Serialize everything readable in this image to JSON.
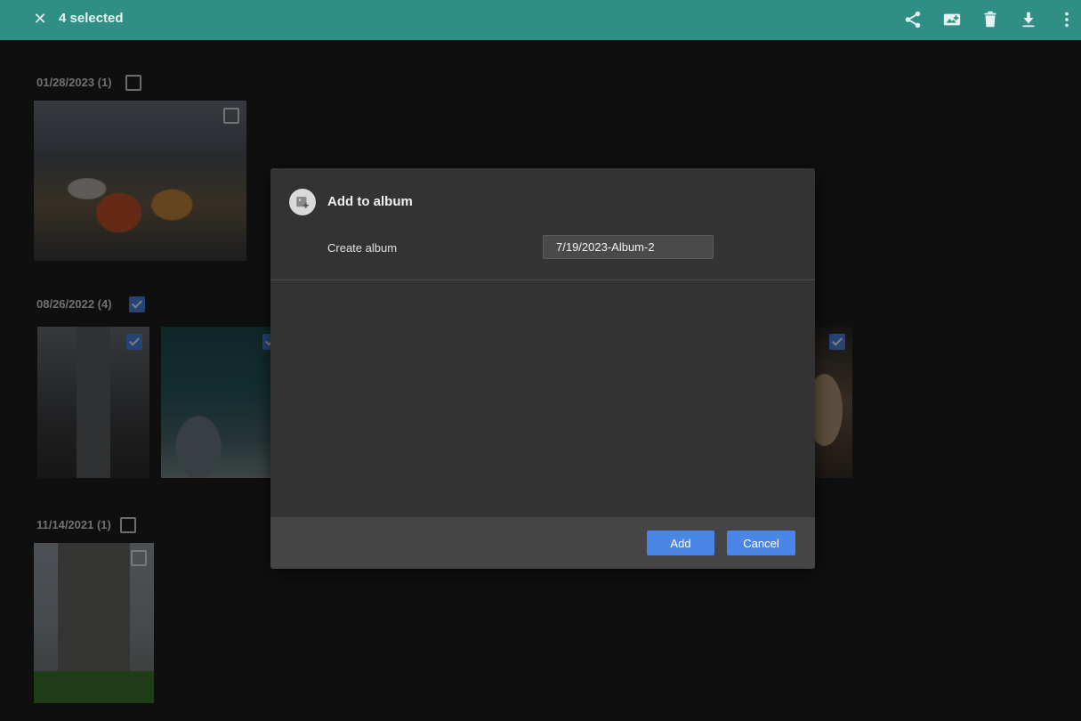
{
  "topbar": {
    "close_glyph": "✕",
    "selected_label": "4 selected",
    "icons": [
      "share-icon",
      "add-to-album-icon",
      "delete-icon",
      "download-icon",
      "more-vert-icon"
    ],
    "accent": "#2f8f84"
  },
  "groups": [
    {
      "label": "01/28/2023 (1)",
      "checked": false,
      "photos": [
        {
          "subject": "market-stall-photo",
          "checked": false
        }
      ]
    },
    {
      "label": "08/26/2022 (4)",
      "checked": true,
      "photos": [
        {
          "subject": "street-photo",
          "checked": true
        },
        {
          "subject": "aquarium-photo",
          "checked": true
        },
        {
          "subject": "cave-photo",
          "checked": true
        }
      ]
    },
    {
      "label": "11/14/2021 (1)",
      "checked": false,
      "photos": [
        {
          "subject": "building-photo",
          "checked": false
        }
      ]
    }
  ],
  "dialog": {
    "title": "Add to album",
    "create_label": "Create album",
    "album_name": "7/19/2023-Album-2",
    "add_label": "Add",
    "cancel_label": "Cancel",
    "button_color": "#4a86e8"
  }
}
